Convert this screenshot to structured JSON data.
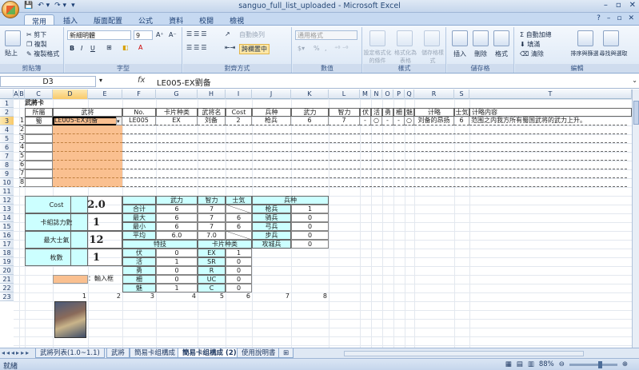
{
  "window": {
    "title": "sanguo_full_list_uploaded - Microsoft Excel",
    "controls": [
      "–",
      "▫",
      "✕"
    ],
    "quick_access": [
      "💾",
      "↶ ▾",
      "↷ ▾",
      "▾"
    ]
  },
  "ribbon_tabs": [
    "常用",
    "插入",
    "版面配置",
    "公式",
    "資料",
    "校閱",
    "檢視"
  ],
  "ribbon_tabs_right": [
    "?",
    "–",
    "▫",
    "✕"
  ],
  "ribbon": {
    "clipboard": {
      "paste": "貼上",
      "cut": "剪下",
      "copy": "複製",
      "format_painter": "複製格式",
      "label": "剪貼簿"
    },
    "font": {
      "name": "新細明體",
      "size": "9",
      "grow": "A⁺",
      "shrink": "A⁻",
      "bold": "B",
      "italic": "I",
      "underline": "U",
      "label": "字型"
    },
    "alignment": {
      "wrap": "自動換列",
      "merge": "跨欄置中",
      "label": "對齊方式"
    },
    "number": {
      "format": "通用格式",
      "percent": "%",
      "comma": ",",
      "label": "數值"
    },
    "styles": {
      "conditional": "設定格式化的條件",
      "as_table": "格式化為表格",
      "cell_styles": "儲存格樣式",
      "label": "樣式"
    },
    "cells": {
      "insert": "插入",
      "delete": "刪除",
      "format": "格式",
      "label": "儲存格"
    },
    "editing": {
      "autosum": "自動加總",
      "fill": "填滿",
      "clear": "清除",
      "sort": "排序與篩選",
      "find": "尋找與選取",
      "label": "編輯"
    }
  },
  "formula_bar": {
    "name_box": "D3",
    "fx": "fx",
    "content": "LE005-EX劉备"
  },
  "columns": [
    "A",
    "B",
    "C",
    "D",
    "E",
    "F",
    "G",
    "H",
    "I",
    "J",
    "K",
    "L",
    "M",
    "N",
    "O",
    "P",
    "Q",
    "R",
    "S",
    "T"
  ],
  "rows": [
    "1",
    "2",
    "3",
    "4",
    "5",
    "6",
    "7",
    "8",
    "9",
    "10",
    "11",
    "12",
    "13",
    "14",
    "15",
    "16",
    "17",
    "18",
    "19",
    "20",
    "21",
    "22",
    "23"
  ],
  "sheet": {
    "title": "武將卡",
    "headers": {
      "belong": "所屬",
      "general": "武将",
      "no": "No.",
      "card_type": "卡片种类",
      "name": "武将名",
      "cost": "Cost",
      "troop": "兵种",
      "force": "武力",
      "intel": "智力",
      "s1": "伏",
      "s2": "活",
      "s3": "勇",
      "s4": "柵",
      "s5": "魅",
      "tactic": "计略",
      "morale": "士気",
      "tactic_desc": "计略内容"
    },
    "row3": {
      "idx": "1",
      "belong": "蜀",
      "general": "LE005-EX刘备",
      "no": "LE005",
      "card_type": "EX",
      "name": "刘备",
      "cost": "2",
      "troop": "枪兵",
      "force": "6",
      "intel": "7",
      "s1": "-",
      "s2": "○",
      "s3": "-",
      "s4": "-",
      "s5": "○",
      "tactic": "刘备的昂扬",
      "morale": "6",
      "tactic_desc": "范围之内我方所有蜀国武将的武力上升。"
    },
    "row_indices": [
      "2",
      "3",
      "4",
      "5",
      "6",
      "7",
      "8"
    ],
    "summary": {
      "cost_label": "Cost",
      "cost_value": "2.0",
      "units_label": "卡組誌力數",
      "units_value": "1",
      "morale_label": "最大士氣",
      "morale_value": "12",
      "count_label": "枚數",
      "count_value": "1",
      "legend_text": "：輸入框"
    },
    "stats": {
      "head": [
        "武力",
        "智力",
        "士気"
      ],
      "rows": [
        {
          "label": "合计",
          "v": [
            "6",
            "7",
            ""
          ]
        },
        {
          "label": "最大",
          "v": [
            "6",
            "7",
            "6"
          ]
        },
        {
          "label": "最小",
          "v": [
            "6",
            "7",
            "6"
          ]
        },
        {
          "label": "平均",
          "v": [
            "6.0",
            "7.0",
            ""
          ]
        }
      ],
      "troop_head": "兵种",
      "troops": [
        {
          "label": "枪兵",
          "v": "1"
        },
        {
          "label": "骑兵",
          "v": "0"
        },
        {
          "label": "弓兵",
          "v": "0"
        },
        {
          "label": "步兵",
          "v": "0"
        },
        {
          "label": "攻城兵",
          "v": "0"
        }
      ],
      "skill_head": "特技",
      "skills": [
        {
          "label": "伏",
          "v": "0"
        },
        {
          "label": "活",
          "v": "1"
        },
        {
          "label": "勇",
          "v": "0"
        },
        {
          "label": "柵",
          "v": "0"
        },
        {
          "label": "魅",
          "v": "1"
        }
      ],
      "cardtype_head": "卡片种类",
      "cardtypes": [
        {
          "label": "EX",
          "v": "1"
        },
        {
          "label": "SR",
          "v": "0"
        },
        {
          "label": "R",
          "v": "0"
        },
        {
          "label": "UC",
          "v": "0"
        },
        {
          "label": "C",
          "v": "0"
        }
      ]
    },
    "row23_nums": [
      "1",
      "2",
      "3",
      "4",
      "5",
      "6",
      "7",
      "8"
    ]
  },
  "sheet_tabs": [
    "武將列表(1.0~1.1)",
    "武將",
    "簡易卡组構成",
    "簡易卡组構成 (2)",
    "使用說明書"
  ],
  "active_sheet_index": 3,
  "status": {
    "ready": "就緒",
    "zoom": "88%"
  },
  "colors": {
    "input_fill": "#fac090",
    "stats_fill": "#ccffff"
  }
}
